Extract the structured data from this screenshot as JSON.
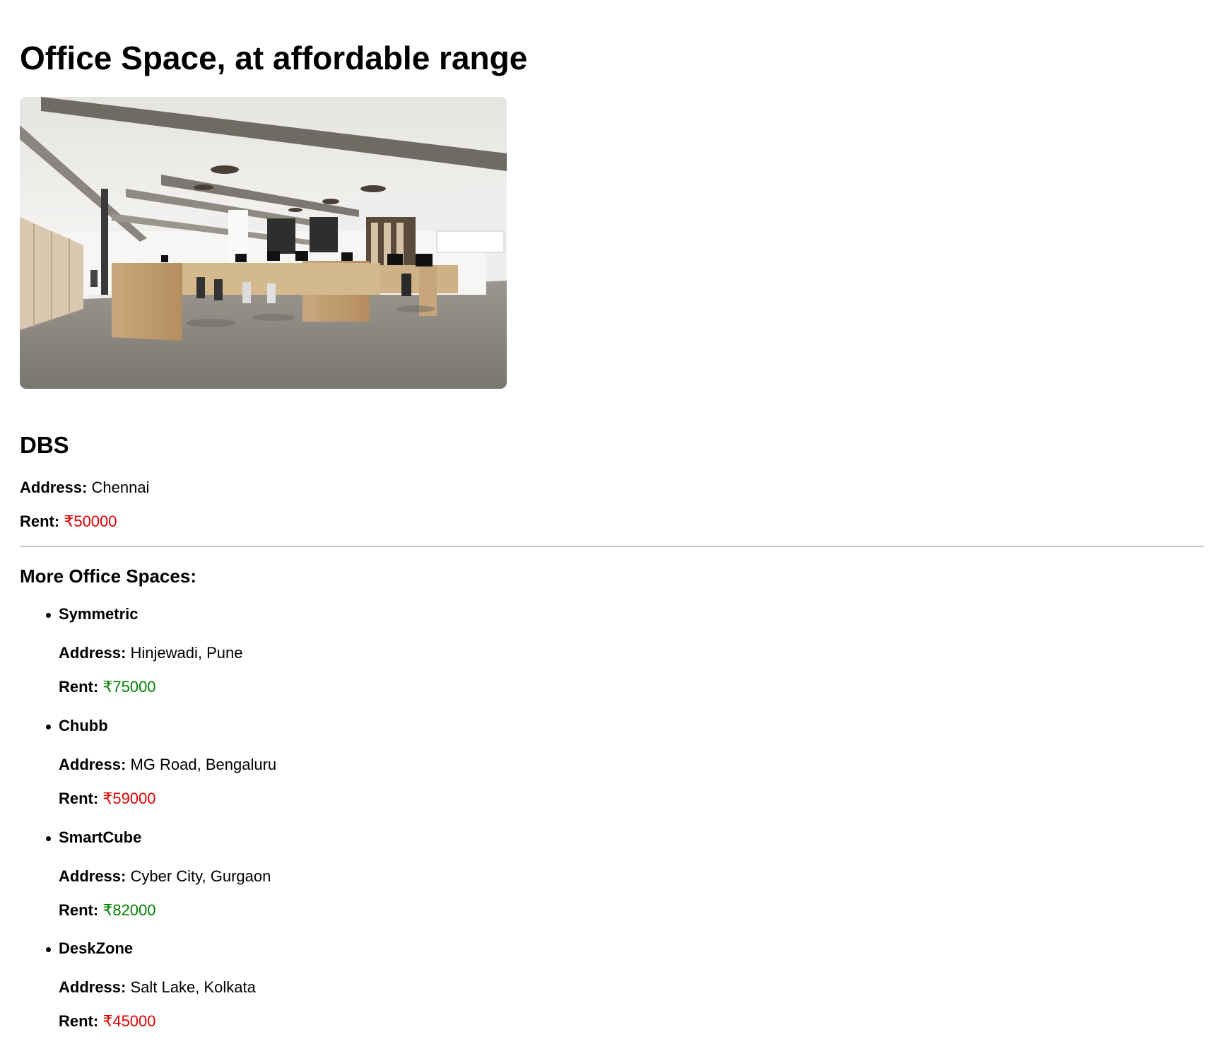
{
  "page": {
    "title": "Office Space, at affordable range"
  },
  "hero_image": {
    "alt": "office-interior-photo"
  },
  "main_office": {
    "name": "DBS",
    "address_label": "Address:",
    "address": "Chennai",
    "rent_label": "Rent:",
    "rent": "₹50000",
    "rent_color": "#e00000"
  },
  "more": {
    "heading": "More Office Spaces:",
    "items": [
      {
        "name": "Symmetric",
        "address_label": "Address:",
        "address": "Hinjewadi, Pune",
        "rent_label": "Rent:",
        "rent": "₹75000",
        "rent_color": "#008000"
      },
      {
        "name": "Chubb",
        "address_label": "Address:",
        "address": "MG Road, Bengaluru",
        "rent_label": "Rent:",
        "rent": "₹59000",
        "rent_color": "#e00000"
      },
      {
        "name": "SmartCube",
        "address_label": "Address:",
        "address": "Cyber City, Gurgaon",
        "rent_label": "Rent:",
        "rent": "₹82000",
        "rent_color": "#008000"
      },
      {
        "name": "DeskZone",
        "address_label": "Address:",
        "address": "Salt Lake, Kolkata",
        "rent_label": "Rent:",
        "rent": "₹45000",
        "rent_color": "#e00000"
      }
    ]
  },
  "colors": {
    "rent_above_60000": "#008000",
    "rent_below_60000": "#e00000",
    "divider": "#c8c8c8"
  }
}
